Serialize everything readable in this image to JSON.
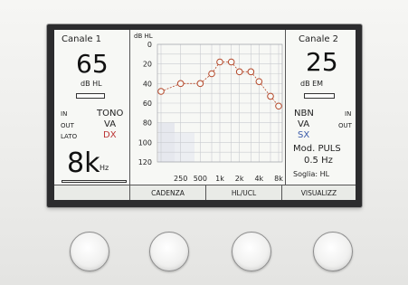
{
  "left": {
    "channel": "Canale  1",
    "level": "65",
    "unit": "dB  HL",
    "in": "IN",
    "out": "OUT",
    "lato": "LATO",
    "mode": "TONO",
    "route": "VA",
    "side": "DX",
    "freq_value": "8k",
    "freq_unit": "Hz"
  },
  "right": {
    "channel": "Canale  2",
    "level": "25",
    "unit": "dB  EM",
    "noise": "NBN",
    "in": "IN",
    "route": "VA",
    "out": "OUT",
    "side": "SX",
    "mod": "Mod.  PULS",
    "mod_rate": "0.5  Hz",
    "threshold": "Soglia:  HL"
  },
  "softkeys": [
    "",
    "CADENZA",
    "HL/UCL",
    "VISUALIZZ"
  ],
  "chart_data": {
    "type": "line",
    "ylabel": "dB HL",
    "y_ticks": [
      "0",
      "20",
      "40",
      "60",
      "80",
      "100",
      "120"
    ],
    "ylim": [
      0,
      120
    ],
    "y_inverted": true,
    "x_ticks": [
      "250",
      "500",
      "1k",
      "2k",
      "4k",
      "8k"
    ],
    "x": [
      "125",
      "250",
      "500",
      "750",
      "1k",
      "1.5k",
      "2k",
      "3k",
      "4k",
      "6k",
      "8k"
    ],
    "series": [
      {
        "values": [
          48,
          40,
          40,
          30,
          18,
          18,
          28,
          28,
          38,
          53,
          63
        ],
        "marker": "circle",
        "color": "#b5482a"
      }
    ],
    "grid": true
  }
}
